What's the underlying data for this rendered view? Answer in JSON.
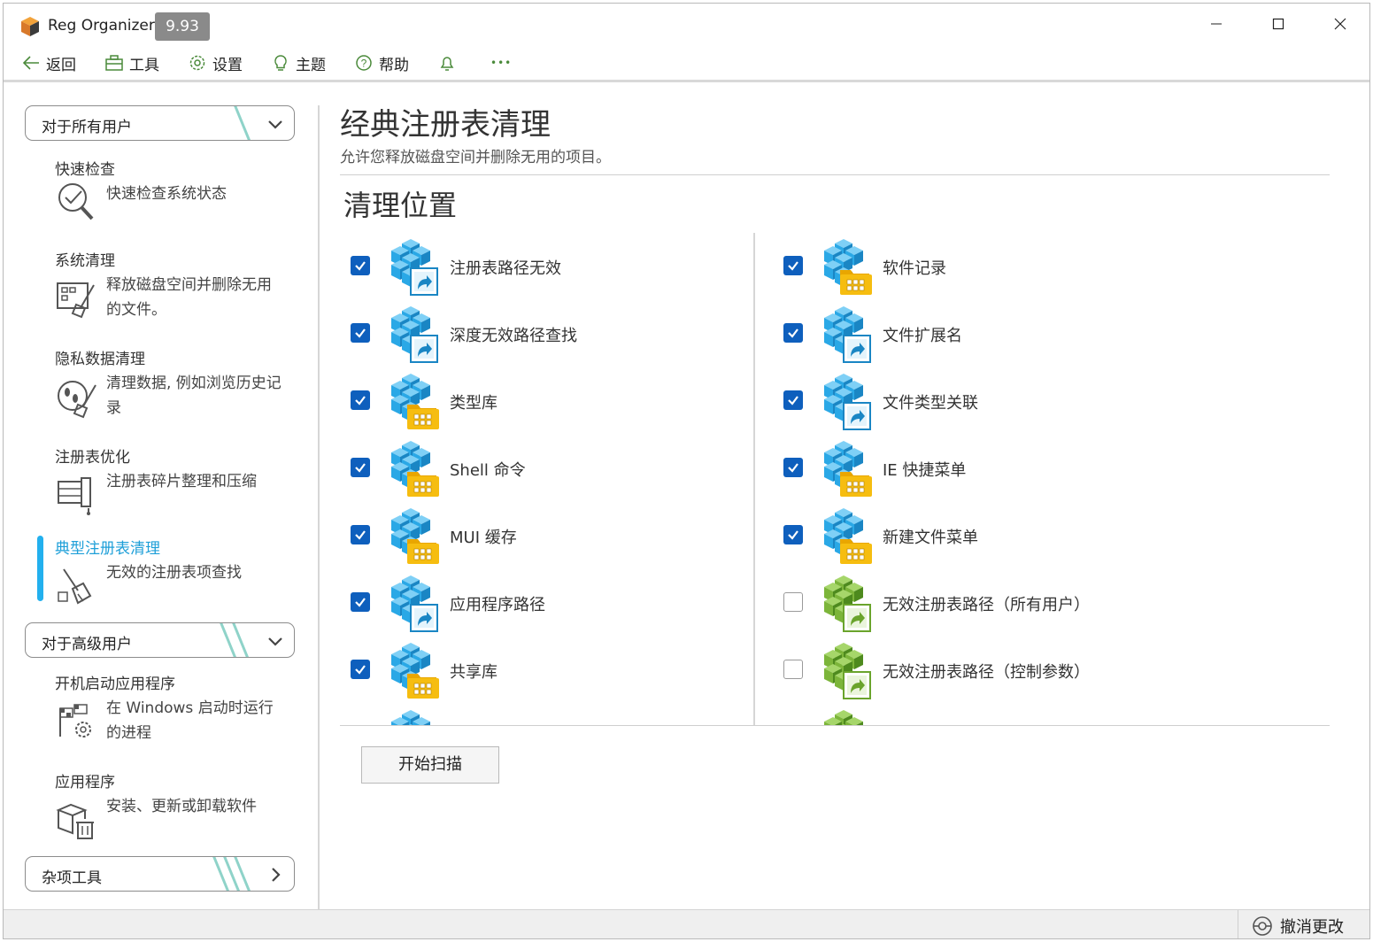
{
  "window": {
    "app_title": "Reg Organizer",
    "version": "9.93"
  },
  "toolbar": {
    "back": "返回",
    "tools": "工具",
    "settings": "设置",
    "theme": "主题",
    "help": "帮助",
    "more": "•••"
  },
  "sidebar": {
    "group_all_users": "对于所有用户",
    "group_advanced": "对于高级用户",
    "group_misc": "杂项工具",
    "items": [
      {
        "title": "快速检查",
        "desc": "快速检查系统状态"
      },
      {
        "title": "系统清理",
        "desc": "释放磁盘空间并删除无用的文件。"
      },
      {
        "title": "隐私数据清理",
        "desc": "清理数据, 例如浏览历史记录"
      },
      {
        "title": "注册表优化",
        "desc": "注册表碎片整理和压缩"
      },
      {
        "title": "典型注册表清理",
        "desc": "无效的注册表项查找"
      },
      {
        "title": "开机启动应用程序",
        "desc": "在 Windows 启动时运行的进程"
      },
      {
        "title": "应用程序",
        "desc": "安装、更新或卸载软件"
      }
    ]
  },
  "main": {
    "title": "经典注册表清理",
    "subtitle": "允许您释放磁盘空间并删除无用的项目。",
    "section_title": "清理位置",
    "scan_button": "开始扫描",
    "left_items": [
      {
        "label": "注册表路径无效",
        "checked": true,
        "icon": "registry-shortcut-icon"
      },
      {
        "label": "深度无效路径查找",
        "checked": true,
        "icon": "registry-shortcut-icon"
      },
      {
        "label": "类型库",
        "checked": true,
        "icon": "registry-folder-icon"
      },
      {
        "label": "Shell 命令",
        "checked": true,
        "icon": "registry-folder-icon"
      },
      {
        "label": "MUI 缓存",
        "checked": true,
        "icon": "registry-folder-icon"
      },
      {
        "label": "应用程序路径",
        "checked": true,
        "icon": "registry-shortcut-icon"
      },
      {
        "label": "共享库",
        "checked": true,
        "icon": "registry-folder-icon"
      }
    ],
    "right_items": [
      {
        "label": "软件记录",
        "checked": true,
        "icon": "registry-folder-icon"
      },
      {
        "label": "文件扩展名",
        "checked": true,
        "icon": "registry-shortcut-icon"
      },
      {
        "label": "文件类型关联",
        "checked": true,
        "icon": "registry-shortcut-icon"
      },
      {
        "label": "IE 快捷菜单",
        "checked": true,
        "icon": "registry-folder-icon"
      },
      {
        "label": "新建文件菜单",
        "checked": true,
        "icon": "registry-folder-icon"
      },
      {
        "label": "无效注册表路径（所有用户）",
        "checked": false,
        "icon": "registry-green-shortcut-icon"
      },
      {
        "label": "无效注册表路径（控制参数）",
        "checked": false,
        "icon": "registry-green-shortcut-icon"
      }
    ]
  },
  "statusbar": {
    "undo": "撤消更改"
  },
  "colors": {
    "accent": "#1e9fd8",
    "checkbox": "#0e5fbd",
    "cube_blue": "#2aa8e6",
    "cube_green": "#7cb53a",
    "folder": "#f6bd10"
  }
}
